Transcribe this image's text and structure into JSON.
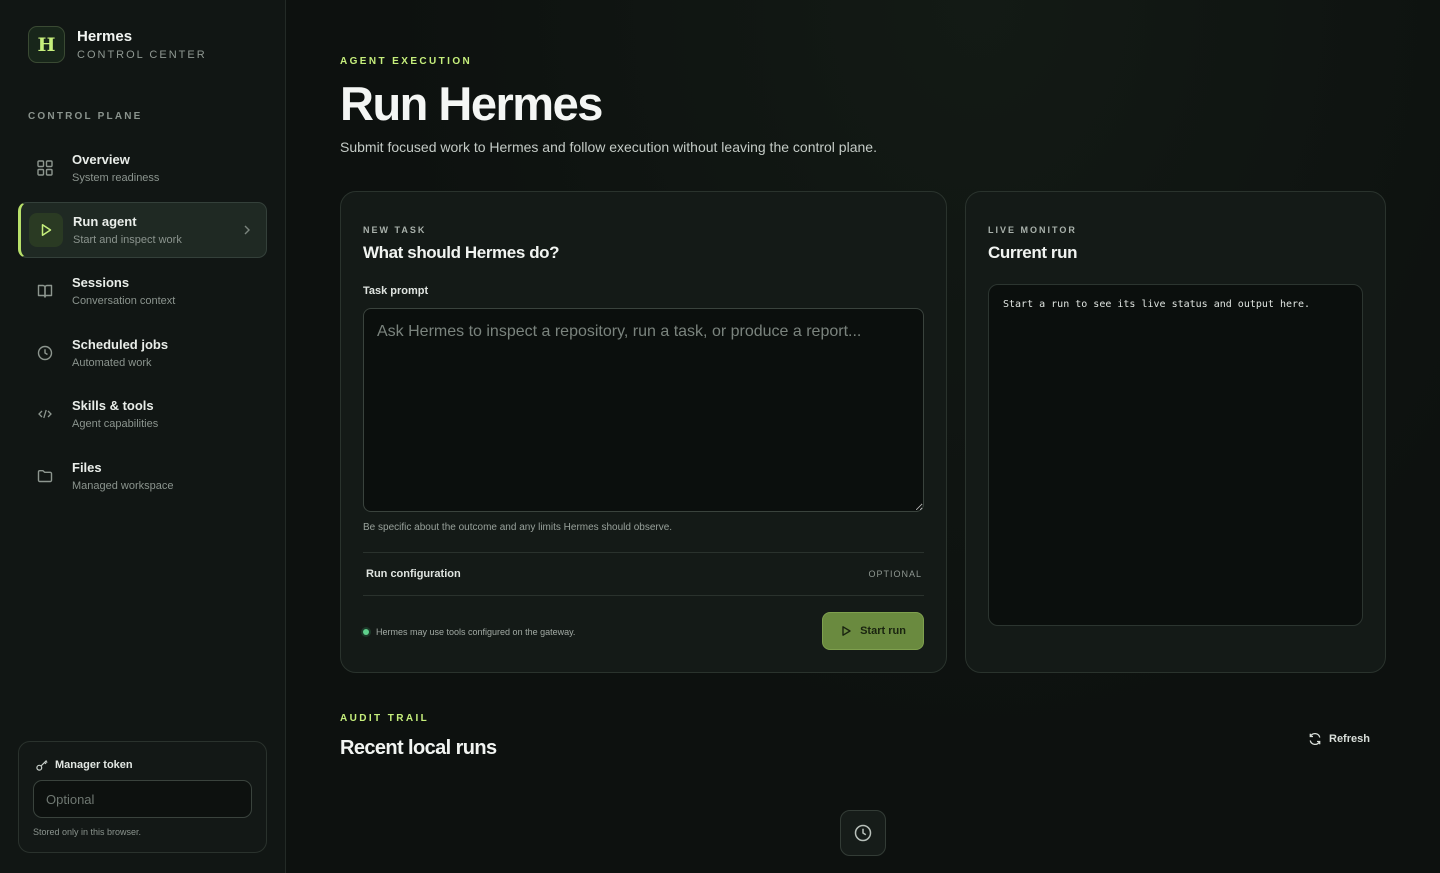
{
  "brand": {
    "logo_letter": "H",
    "name": "Hermes",
    "subtitle": "CONTROL CENTER"
  },
  "sidebar": {
    "section_label": "CONTROL PLANE",
    "items": [
      {
        "title": "Overview",
        "subtitle": "System readiness",
        "icon": "grid-icon",
        "active": false
      },
      {
        "title": "Run agent",
        "subtitle": "Start and inspect work",
        "icon": "play-icon",
        "active": true
      },
      {
        "title": "Sessions",
        "subtitle": "Conversation context",
        "icon": "book-icon",
        "active": false
      },
      {
        "title": "Scheduled jobs",
        "subtitle": "Automated work",
        "icon": "clock-icon",
        "active": false
      },
      {
        "title": "Skills & tools",
        "subtitle": "Agent capabilities",
        "icon": "code-icon",
        "active": false
      },
      {
        "title": "Files",
        "subtitle": "Managed workspace",
        "icon": "folder-icon",
        "active": false
      }
    ],
    "token": {
      "label": "Manager token",
      "placeholder": "Optional",
      "value": "",
      "note": "Stored only in this browser."
    }
  },
  "page": {
    "eyebrow": "AGENT EXECUTION",
    "title": "Run Hermes",
    "description": "Submit focused work to Hermes and follow execution without leaving the control plane."
  },
  "task": {
    "eyebrow": "NEW TASK",
    "title": "What should Hermes do?",
    "prompt_label": "Task prompt",
    "prompt_placeholder": "Ask Hermes to inspect a repository, run a task, or produce a report...",
    "prompt_value": "",
    "hint": "Be specific about the outcome and any limits Hermes should observe.",
    "config_title": "Run configuration",
    "config_badge": "OPTIONAL",
    "gateway_note": "Hermes may use tools configured on the gateway.",
    "start_label": "Start run"
  },
  "monitor": {
    "eyebrow": "LIVE MONITOR",
    "title": "Current run",
    "output": "Start a run to see its live status and output here."
  },
  "audit": {
    "eyebrow": "AUDIT TRAIL",
    "title": "Recent local runs",
    "refresh_label": "Refresh"
  },
  "colors": {
    "accent": "#c6ef7c",
    "button": "#6a8a3f",
    "status_dot": "#5fd08c",
    "background": "#0d110f"
  }
}
